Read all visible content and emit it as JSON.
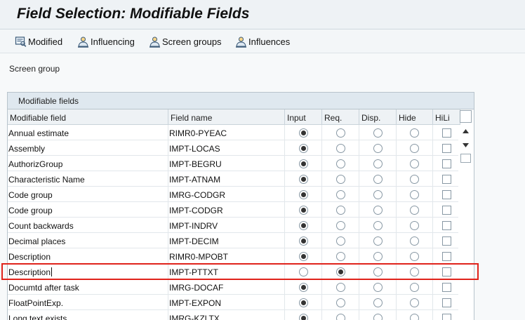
{
  "window": {
    "title": "Field Selection: Modifiable Fields"
  },
  "toolbar": {
    "modified": "Modified",
    "influencing": "Influencing",
    "screen_groups": "Screen groups",
    "influences": "Influences"
  },
  "screen_group": {
    "label": "Screen group"
  },
  "table": {
    "title": "Modifiable fields",
    "columns": [
      "Modifiable field",
      "Field name",
      "Input",
      "Req.",
      "Disp.",
      "Hide",
      "HiLi"
    ],
    "rows": [
      {
        "field": "Annual estimate",
        "name": "RIMR0-PYEAC",
        "mode": "Input",
        "hili": false
      },
      {
        "field": "Assembly",
        "name": "IMPT-LOCAS",
        "mode": "Input",
        "hili": false
      },
      {
        "field": "AuthorizGroup",
        "name": "IMPT-BEGRU",
        "mode": "Input",
        "hili": false
      },
      {
        "field": "Characteristic Name",
        "name": "IMPT-ATNAM",
        "mode": "Input",
        "hili": false
      },
      {
        "field": "Code group",
        "name": "IMRG-CODGR",
        "mode": "Input",
        "hili": false
      },
      {
        "field": "Code group",
        "name": "IMPT-CODGR",
        "mode": "Input",
        "hili": false
      },
      {
        "field": "Count backwards",
        "name": "IMPT-INDRV",
        "mode": "Input",
        "hili": false
      },
      {
        "field": "Decimal places",
        "name": "IMPT-DECIM",
        "mode": "Input",
        "hili": false
      },
      {
        "field": "Description",
        "name": "RIMR0-MPOBT",
        "mode": "Input",
        "hili": false
      },
      {
        "field": "Description",
        "name": "IMPT-PTTXT",
        "mode": "Req.",
        "hili": false
      },
      {
        "field": "Documtd after task",
        "name": "IMRG-DOCAF",
        "mode": "Input",
        "hili": false
      },
      {
        "field": "FloatPointExp.",
        "name": "IMPT-EXPON",
        "mode": "Input",
        "hili": false
      },
      {
        "field": "Long text exists",
        "name": "IMRG-KZLTX",
        "mode": "Input",
        "hili": false
      }
    ]
  },
  "colors": {
    "highlight": "#e0231b",
    "header_bg": "#dfe8ef"
  }
}
